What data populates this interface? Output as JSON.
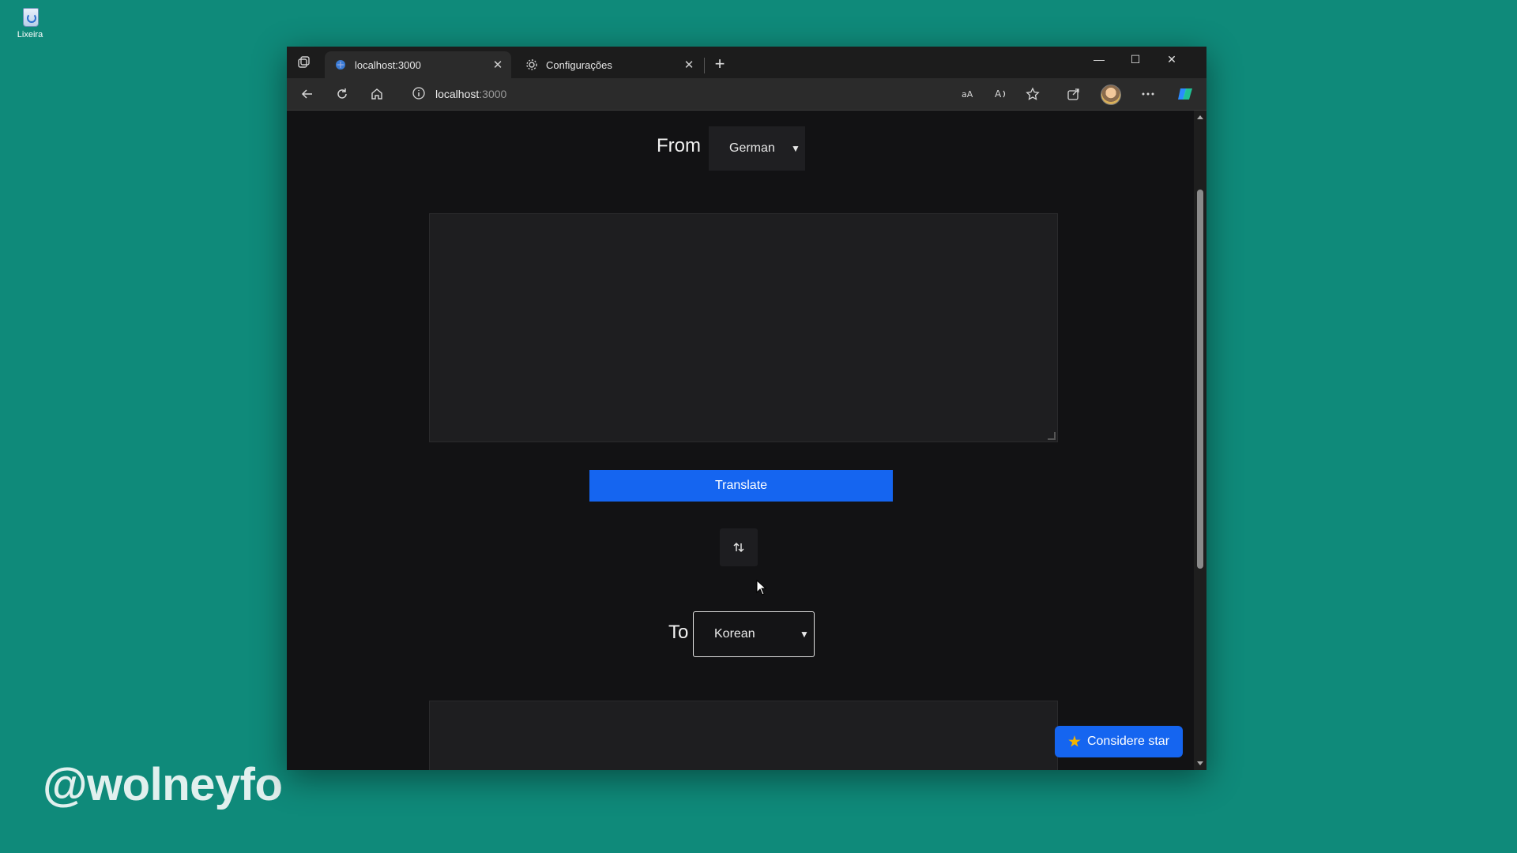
{
  "desktop": {
    "recycle_bin_label": "Lixeira",
    "watermark": "@wolneyfo"
  },
  "browser": {
    "tabs": [
      {
        "label": "localhost:3000",
        "active": true
      },
      {
        "label": "Configurações",
        "active": false
      }
    ],
    "address": {
      "host": "localhost",
      "port": ":3000"
    }
  },
  "page": {
    "from_label": "From",
    "from_language": "German",
    "source_text": "",
    "translate_label": "Translate",
    "swap_icon": "swap-vertical-icon",
    "to_label": "To",
    "to_language": "Korean",
    "output_text": "",
    "star_label": "Considere star"
  },
  "colors": {
    "desktop_bg": "#0f8a7a",
    "page_bg": "#121214",
    "accent_blue": "#1565f0",
    "star_yellow": "#f4b400"
  }
}
